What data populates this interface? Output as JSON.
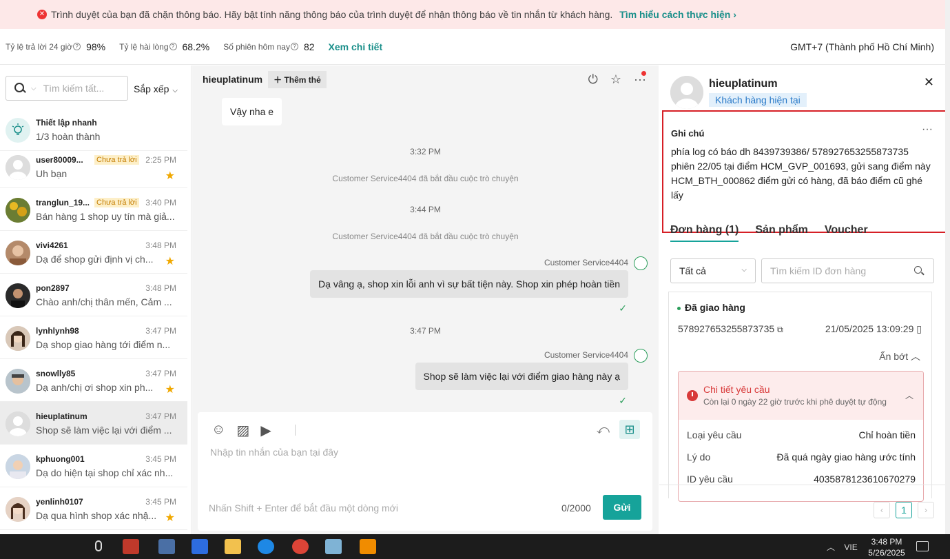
{
  "banner": {
    "message": "Trình duyệt của bạn đã chặn thông báo. Hãy bật tính năng thông báo của trình duyệt để nhận thông báo về tin nhắn từ khách hàng.",
    "link": "Tìm hiểu cách thực hiện ›"
  },
  "stats": {
    "reply_rate_label": "Tỷ lệ trả lời 24 giờ",
    "reply_rate_value": "98%",
    "satisfaction_label": "Tỷ lệ hài lòng",
    "satisfaction_value": "68.2%",
    "sessions_label": "Số phiên hôm nay",
    "sessions_value": "82",
    "detail_link": "Xem chi tiết",
    "timezone": "GMT+7 (Thành phố Hồ Chí Minh)"
  },
  "sidebar": {
    "search_placeholder": "Tìm kiếm tất...",
    "sort_label": "Sắp xếp",
    "quick_setup": {
      "title": "Thiết lập nhanh",
      "progress": "1/3 hoàn thành"
    },
    "conversations": [
      {
        "name": "user80009...",
        "tag": "Chưa trả lời",
        "time": "2:25 PM",
        "preview": "Uh bạn",
        "starred": true
      },
      {
        "name": "tranglun_19...",
        "tag": "Chưa trả lời",
        "time": "3:40 PM",
        "preview": "Bán hàng 1 shop uy tín mà giả...",
        "starred": false
      },
      {
        "name": "vivi4261",
        "tag": "",
        "time": "3:48 PM",
        "preview": "Dạ để shop gửi định vị ch...",
        "starred": true
      },
      {
        "name": "pon2897",
        "tag": "",
        "time": "3:48 PM",
        "preview": "Chào anh/chị thân mến, Cảm ...",
        "starred": false
      },
      {
        "name": "lynhlynh98",
        "tag": "",
        "time": "3:47 PM",
        "preview": "Dạ shop giao hàng tới điểm n...",
        "starred": false
      },
      {
        "name": "snowlly85",
        "tag": "",
        "time": "3:47 PM",
        "preview": "Dạ anh/chị ơi shop xin ph...",
        "starred": true
      },
      {
        "name": "hieuplatinum",
        "tag": "",
        "time": "3:47 PM",
        "preview": "Shop sẽ làm việc lại với điểm ...",
        "starred": false
      },
      {
        "name": "kphuong001",
        "tag": "",
        "time": "3:45 PM",
        "preview": "Dạ do hiện tại shop chỉ xác nh...",
        "starred": false
      },
      {
        "name": "yenlinh0107",
        "tag": "",
        "time": "3:45 PM",
        "preview": "Dạ qua hình shop xác nhậ...",
        "starred": true
      }
    ]
  },
  "chat": {
    "username": "hieuplatinum",
    "add_tag": "Thêm thẻ",
    "incoming_message": "Vậy nha e",
    "time_1": "3:32 PM",
    "system_1": "Customer Service4404 đã bắt đầu cuộc trò chuyện",
    "time_2": "3:44 PM",
    "system_2": "Customer Service4404 đã bắt đầu cuộc trò chuyện",
    "sender_1": "Customer Service4404",
    "outgoing_1": "Dạ vâng ạ, shop xin lỗi anh vì sự bất tiện này. Shop xin phép hoàn tiền",
    "time_3": "3:47 PM",
    "sender_2": "Customer Service4404",
    "outgoing_2": "Shop sẽ làm việc lại với điểm giao hàng này ạ",
    "input_placeholder": "Nhập tin nhắn của bạn tại đây",
    "hint": "Nhấn Shift + Enter để bắt đầu một dòng mới",
    "counter": "0/2000",
    "send_label": "Gửi"
  },
  "customer": {
    "name": "hieuplatinum",
    "badge": "Khách hàng hiện tại",
    "note_title": "Ghi chú",
    "note_text": "phía log có báo dh 8439739386/ 578927653255873735 phiên 22/05 tại điểm HCM_GVP_001693, gửi sang điểm này HCM_BTH_000862 điểm gửi có hàng, đã báo điểm cũ ghé lấy",
    "tabs": [
      "Đơn hàng (1)",
      "Sản phẩm",
      "Voucher"
    ],
    "filter_value": "Tất cả",
    "order_search_placeholder": "Tìm kiếm ID đơn hàng",
    "order": {
      "status": "Đã giao hàng",
      "id": "578927653255873735",
      "date": "21/05/2025 13:09:29",
      "collapse": "Ẩn bớt",
      "request_title": "Chi tiết yêu cầu",
      "request_sub": "Còn lại 0 ngày 22 giờ trước khi phê duyệt tự động",
      "rows": [
        {
          "label": "Loại yêu cầu",
          "value": "Chỉ hoàn tiền"
        },
        {
          "label": "Lý do",
          "value": "Đã quá ngày giao hàng ước tính"
        },
        {
          "label": "ID yêu cầu",
          "value": "4035878123610670279"
        }
      ]
    },
    "page": "1"
  },
  "taskbar": {
    "lang": "VIE",
    "time": "3:48 PM",
    "date": "5/26/2025"
  }
}
